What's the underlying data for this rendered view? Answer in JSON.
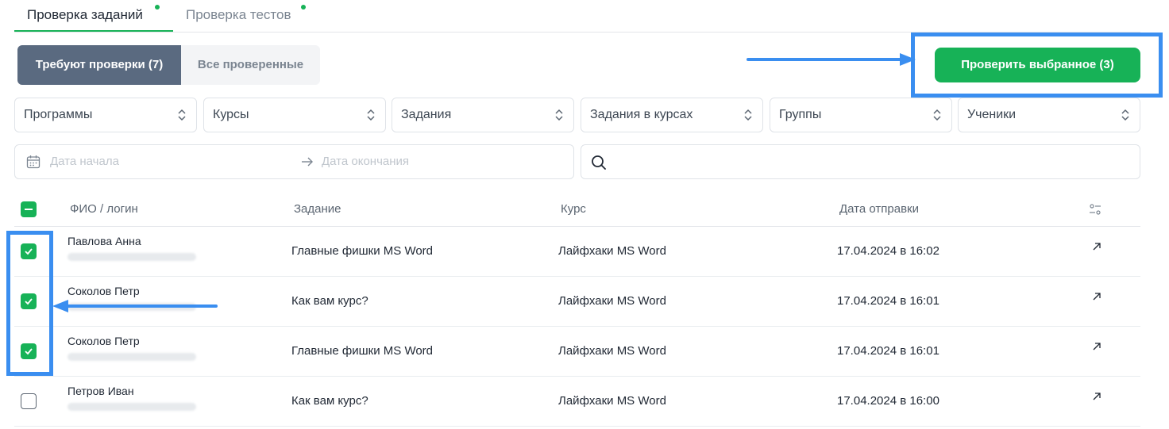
{
  "tabs": [
    {
      "label": "Проверка заданий",
      "active": true,
      "dot": true
    },
    {
      "label": "Проверка тестов",
      "active": false,
      "dot": true
    }
  ],
  "segment": {
    "active_label": "Требуют проверки (7)",
    "inactive_label": "Все проверенные"
  },
  "primary_action": {
    "label": "Проверить выбранное (3)"
  },
  "filters": [
    "Программы",
    "Курсы",
    "Задания",
    "Задания в курсах",
    "Группы",
    "Ученики"
  ],
  "date_range": {
    "start_placeholder": "Дата начала",
    "end_placeholder": "Дата окончания"
  },
  "search": {
    "placeholder": ""
  },
  "table": {
    "columns": [
      "ФИО / логин",
      "Задание",
      "Курс",
      "Дата отправки"
    ],
    "rows": [
      {
        "name": "Павлова Анна",
        "task": "Главные фишки MS Word",
        "course": "Лайфхаки MS Word",
        "date": "17.04.2024 в 16:02",
        "checked": true
      },
      {
        "name": "Соколов Петр",
        "task": "Как вам курс?",
        "course": "Лайфхаки MS Word",
        "date": "17.04.2024 в 16:01",
        "checked": true
      },
      {
        "name": "Соколов Петр",
        "task": "Главные фишки MS Word",
        "course": "Лайфхаки MS Word",
        "date": "17.04.2024 в 16:01",
        "checked": true
      },
      {
        "name": "Петров Иван",
        "task": "Как вам курс?",
        "course": "Лайфхаки MS Word",
        "date": "17.04.2024 в 16:00",
        "checked": false
      }
    ]
  },
  "colors": {
    "accent_green": "#17b257",
    "segment_active": "#5a6a80",
    "annotation_blue": "#3a8ef0"
  },
  "icons": [
    "calendar-icon",
    "arrow-right-icon",
    "search-icon",
    "chevron-updown-icon",
    "column-settings-icon",
    "external-link-icon",
    "check-icon"
  ]
}
